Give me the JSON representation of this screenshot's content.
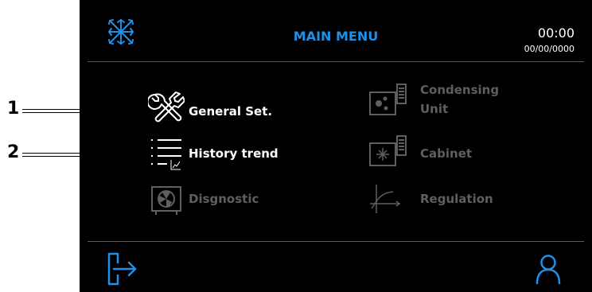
{
  "callouts": [
    "1",
    "2"
  ],
  "header": {
    "title": "MAIN MENU",
    "time": "00:00",
    "date": "00/00/0000"
  },
  "menu": {
    "general": "General Set.",
    "history": "History trend",
    "diagnostic": "Disgnostic",
    "condensing_1": "Condensing",
    "condensing_2": "Unit",
    "cabinet": "Cabinet",
    "regulation": "Regulation"
  },
  "icons": {
    "header": "snowflake-icon",
    "general": "tools-icon",
    "history": "list-trend-icon",
    "diagnostic": "fan-unit-icon",
    "condensing": "condensing-unit-icon",
    "cabinet": "cabinet-icon",
    "regulation": "curve-icon",
    "exit": "logout-icon",
    "user": "user-icon"
  },
  "colors": {
    "accent": "#1e90e8",
    "enabled": "#ffffff",
    "disabled": "#5f5f5f",
    "background": "#000000"
  }
}
